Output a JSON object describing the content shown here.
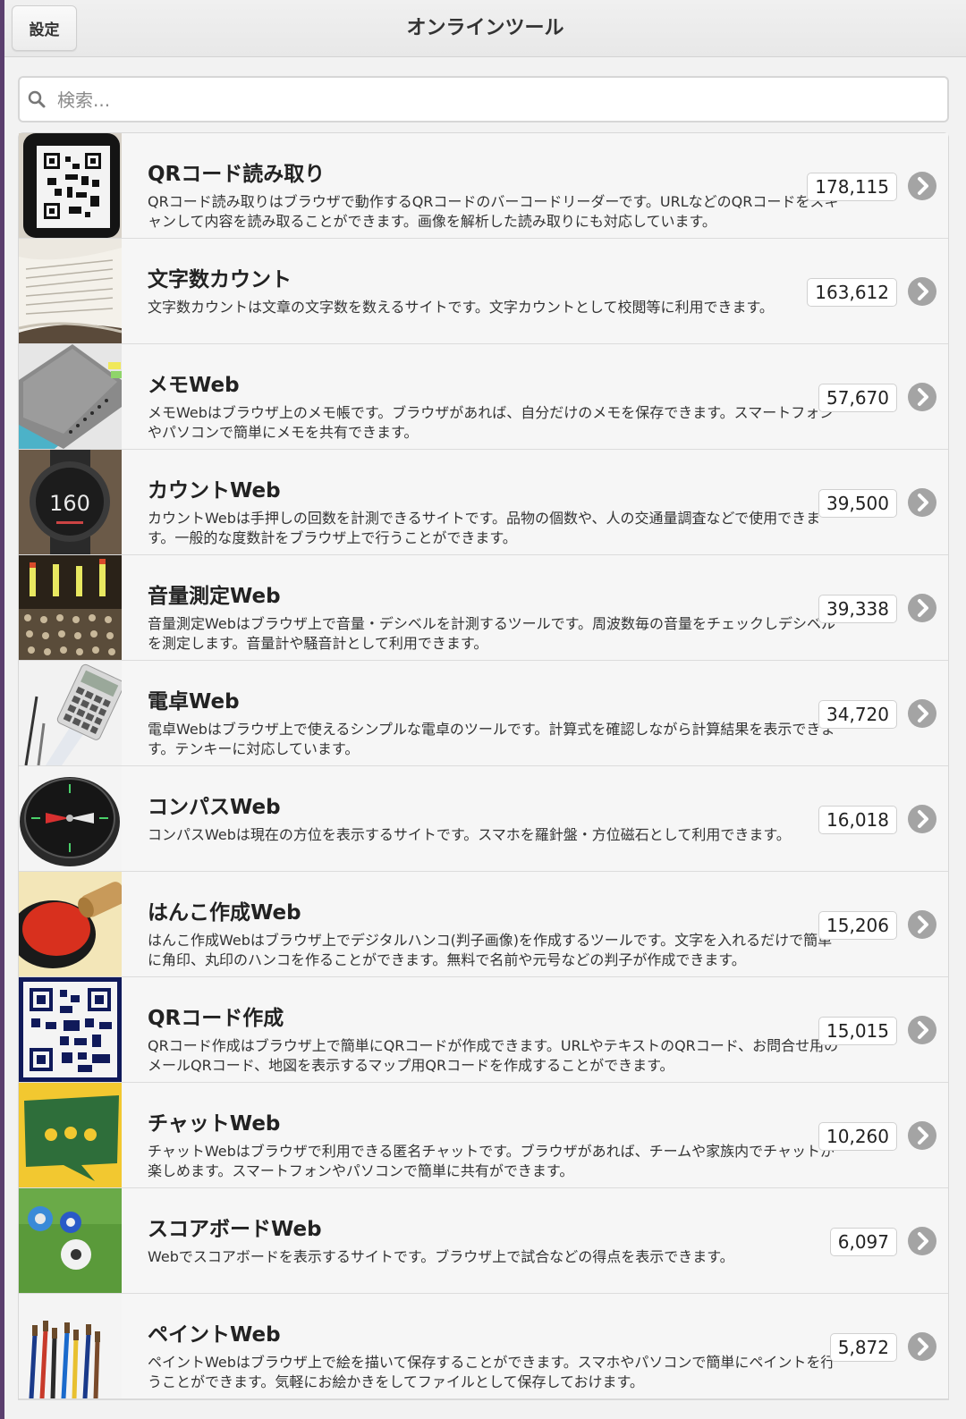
{
  "navbar": {
    "settings_label": "設定",
    "title": "オンラインツール"
  },
  "search": {
    "placeholder": "検索..."
  },
  "tools": [
    {
      "title": "QRコード読み取り",
      "description": "QRコード読み取りはブラウザで動作するQRコードのバーコードリーダーです。URLなどのQRコードをスキャンして内容を読み取ることができます。画像を解析した読み取りにも対応しています。",
      "count": "178,115",
      "icon": "qr-phone-thumbnail"
    },
    {
      "title": "文字数カウント",
      "description": "文字数カウントは文章の文字数を数えるサイトです。文字カウントとして校閲等に利用できます。",
      "count": "163,612",
      "icon": "open-book-thumbnail"
    },
    {
      "title": "メモWeb",
      "description": "メモWebはブラウザ上のメモ帳です。ブラウザがあれば、自分だけのメモを保存できます。スマートフォンやパソコンで簡単にメモを共有できます。",
      "count": "57,670",
      "icon": "notebook-thumbnail"
    },
    {
      "title": "カウントWeb",
      "description": "カウントWebは手押しの回数を計測できるサイトです。品物の個数や、人の交通量調査などで使用できます。一般的な度数計をブラウザ上で行うことができます。",
      "count": "39,500",
      "icon": "watch-counter-thumbnail",
      "thumb_text": "160"
    },
    {
      "title": "音量測定Web",
      "description": "音量測定Webはブラウザ上で音量・デシベルを計測するツールです。周波数毎の音量をチェックしデシベルを測定します。音量計や騒音計として利用できます。",
      "count": "39,338",
      "icon": "mixer-thumbnail"
    },
    {
      "title": "電卓Web",
      "description": "電卓Webはブラウザ上で使えるシンプルな電卓のツールです。計算式を確認しながら計算結果を表示できます。テンキーに対応しています。",
      "count": "34,720",
      "icon": "calculator-thumbnail"
    },
    {
      "title": "コンパスWeb",
      "description": "コンパスWebは現在の方位を表示するサイトです。スマホを羅針盤・方位磁石として利用できます。",
      "count": "16,018",
      "icon": "compass-thumbnail"
    },
    {
      "title": "はんこ作成Web",
      "description": "はんこ作成Webはブラウザ上でデジタルハンコ(判子画像)を作成するツールです。文字を入れるだけで簡単に角印、丸印のハンコを作ることができます。無料で名前や元号などの判子が作成できます。",
      "count": "15,206",
      "icon": "stamp-thumbnail"
    },
    {
      "title": "QRコード作成",
      "description": "QRコード作成はブラウザ上で簡単にQRコードが作成できます。URLやテキストのQRコード、お問合せ用のメールQRコード、地図を表示するマップ用QRコードを作成することができます。",
      "count": "15,015",
      "icon": "qr-code-thumbnail"
    },
    {
      "title": "チャットWeb",
      "description": "チャットWebはブラウザで利用できる匿名チャットです。ブラウザがあれば、チームや家族内でチャットが楽しめます。スマートフォンやパソコンで簡単に共有ができます。",
      "count": "10,260",
      "icon": "chat-bubble-thumbnail"
    },
    {
      "title": "スコアボードWeb",
      "description": "Webでスコアボードを表示するサイトです。ブラウザ上で試合などの得点を表示できます。",
      "count": "6,097",
      "icon": "balls-on-grass-thumbnail"
    },
    {
      "title": "ペイントWeb",
      "description": "ペイントWebはブラウザ上で絵を描いて保存することができます。スマホやパソコンで簡単にペイントを行うことができます。気軽にお絵かきをしてファイルとして保存しておけます。",
      "count": "5,872",
      "icon": "paint-brushes-thumbnail"
    }
  ]
}
